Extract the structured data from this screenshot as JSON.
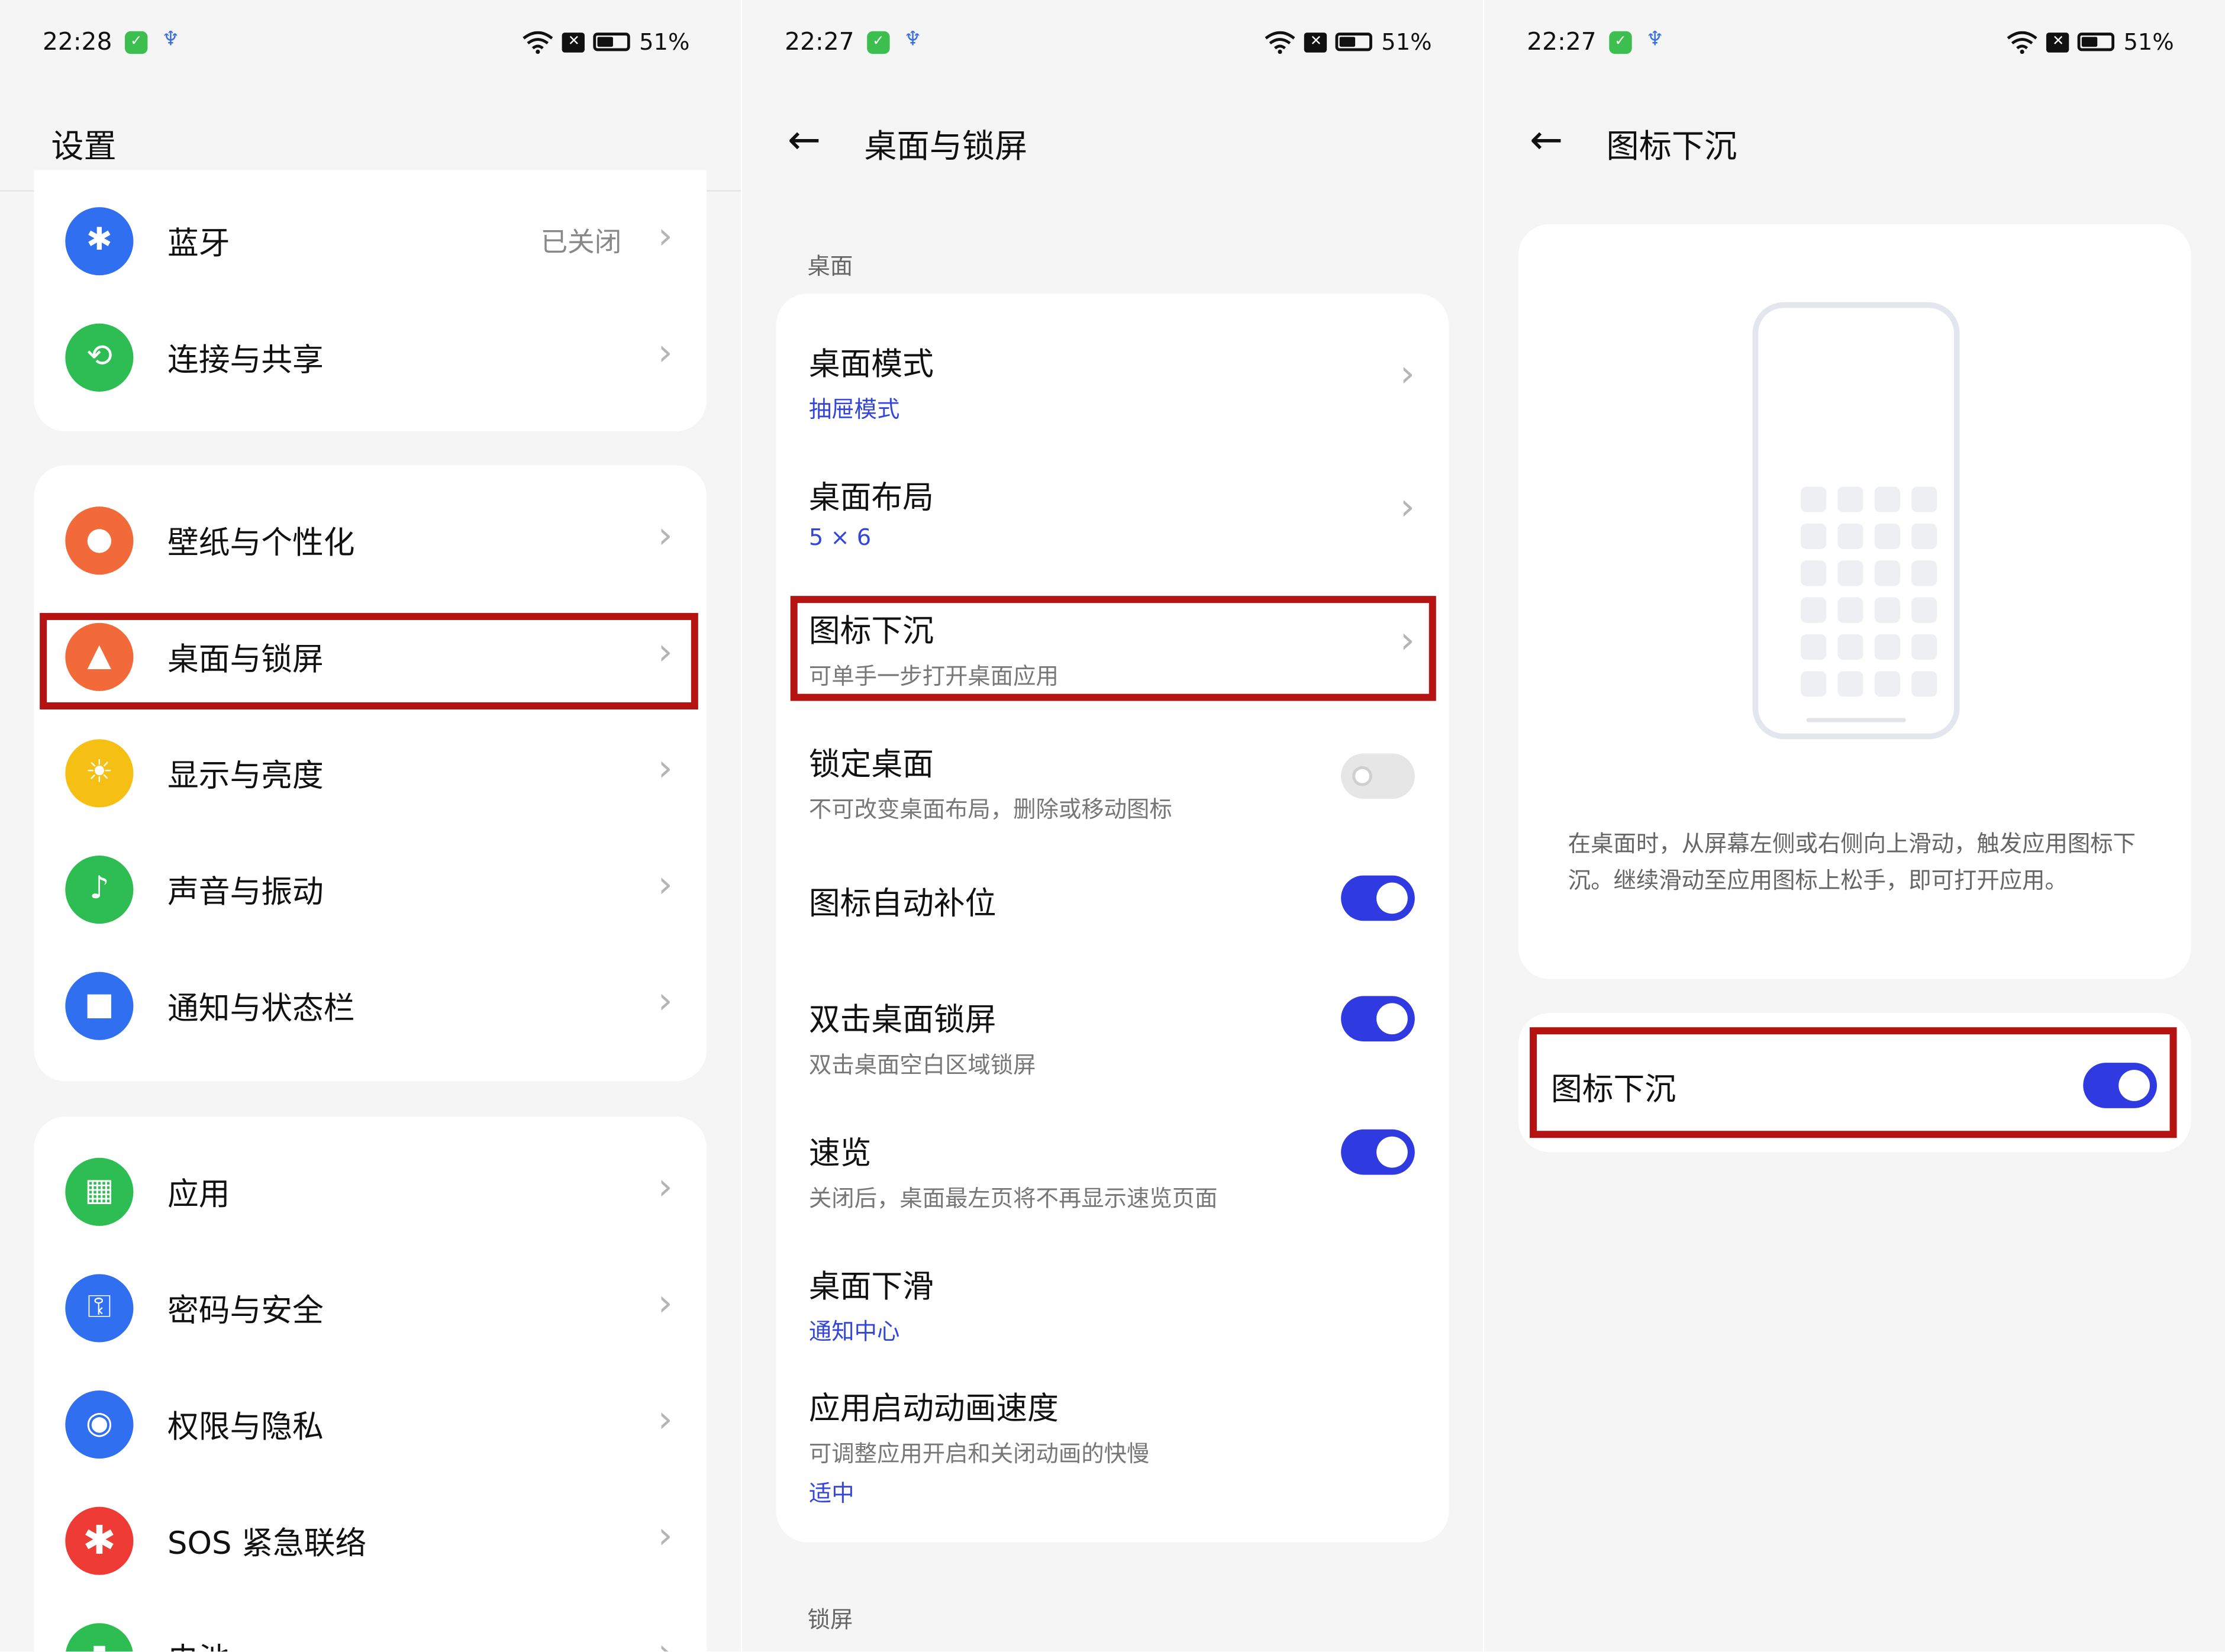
{
  "status_bars": [
    {
      "time": "22:28",
      "battery": "51%"
    },
    {
      "time": "22:27",
      "battery": "51%"
    },
    {
      "time": "22:27",
      "battery": "51%"
    }
  ],
  "settings": {
    "title": "设置",
    "group1": [
      {
        "label": "蓝牙",
        "value": "已关闭",
        "icon": "bluetooth-icon",
        "color": "#2f6ff0"
      },
      {
        "label": "连接与共享",
        "icon": "share-icon",
        "color": "#2dbd52"
      }
    ],
    "group2": [
      {
        "label": "壁纸与个性化",
        "icon": "palette-icon",
        "color": "#f36a3a"
      },
      {
        "label": "桌面与锁屏",
        "icon": "image-icon",
        "color": "#f36a3a"
      },
      {
        "label": "显示与亮度",
        "icon": "sun-icon",
        "color": "#f5bf14"
      },
      {
        "label": "声音与振动",
        "icon": "bell-icon",
        "color": "#2dbd52"
      },
      {
        "label": "通知与状态栏",
        "icon": "notification-icon",
        "color": "#2f6ff0"
      }
    ],
    "group3": [
      {
        "label": "应用",
        "icon": "apps-grid-icon",
        "color": "#2dbd52"
      },
      {
        "label": "密码与安全",
        "icon": "key-icon",
        "color": "#2f6ff0"
      },
      {
        "label": "权限与隐私",
        "icon": "privacy-eye-icon",
        "color": "#2f6ff0"
      },
      {
        "label": "SOS 紧急联络",
        "icon": "sos-asterisk-icon",
        "color": "#ee3b35"
      },
      {
        "label": "电池",
        "icon": "battery-icon",
        "color": "#2dbd52"
      }
    ]
  },
  "desktop": {
    "title": "桌面与锁屏",
    "section_desktop": "桌面",
    "section_lock": "锁屏",
    "items": [
      {
        "title": "桌面模式",
        "value": "抽屉模式"
      },
      {
        "title": "桌面布局",
        "value": "5 × 6"
      },
      {
        "title": "图标下沉",
        "subtitle": "可单手一步打开桌面应用"
      },
      {
        "title": "锁定桌面",
        "subtitle": "不可改变桌面布局，删除或移动图标",
        "toggle": "off"
      },
      {
        "title": "图标自动补位",
        "toggle": "on"
      },
      {
        "title": "双击桌面锁屏",
        "subtitle": "双击桌面空白区域锁屏",
        "toggle": "on"
      },
      {
        "title": "速览",
        "subtitle": "关闭后，桌面最左页将不再显示速览页面",
        "toggle": "on"
      },
      {
        "title": "桌面下滑",
        "value": "通知中心"
      },
      {
        "title": "应用启动动画速度",
        "subtitle": "可调整应用开启和关闭动画的快慢",
        "value": "适中"
      }
    ]
  },
  "icon_sink": {
    "title": "图标下沉",
    "description": "在桌面时，从屏幕左侧或右侧向上滑动，触发应用图标下沉。继续滑动至应用图标上松手，即可打开应用。",
    "toggle_label": "图标下沉",
    "toggle_state": "on"
  }
}
